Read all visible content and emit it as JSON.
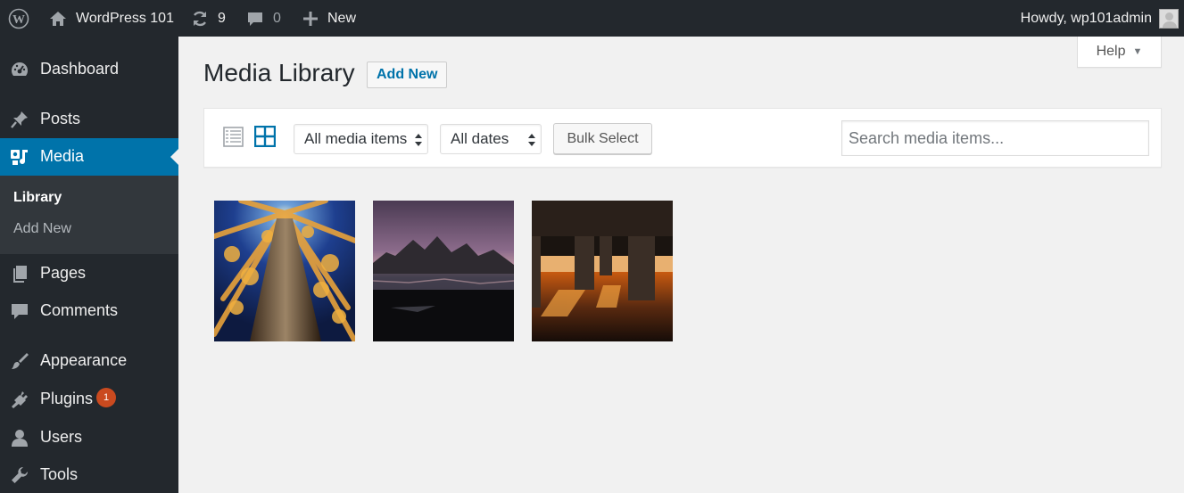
{
  "admin_bar": {
    "site_name": "WordPress 101",
    "updates_count": "9",
    "comments_count": "0",
    "new_label": "New",
    "howdy": "Howdy, wp101admin"
  },
  "sidebar": {
    "items": [
      {
        "label": "Dashboard",
        "icon": "dashboard-icon"
      },
      {
        "label": "Posts",
        "icon": "pin-icon"
      },
      {
        "label": "Media",
        "icon": "media-icon",
        "active": true
      },
      {
        "label": "Pages",
        "icon": "pages-icon"
      },
      {
        "label": "Comments",
        "icon": "comment-icon"
      },
      {
        "label": "Appearance",
        "icon": "brush-icon"
      },
      {
        "label": "Plugins",
        "icon": "plugin-icon",
        "badge": "1"
      },
      {
        "label": "Users",
        "icon": "users-icon"
      },
      {
        "label": "Tools",
        "icon": "wrench-icon"
      }
    ],
    "submenu": [
      {
        "label": "Library",
        "current": true
      },
      {
        "label": "Add New"
      }
    ]
  },
  "help": {
    "label": "Help"
  },
  "page": {
    "title": "Media Library",
    "add_new": "Add New"
  },
  "toolbar": {
    "type_filter": "All media items",
    "date_filter": "All dates",
    "bulk_select": "Bulk Select",
    "search_placeholder": "Search media items..."
  },
  "media_items": [
    {
      "subject": "autumn aspen trees looking up"
    },
    {
      "subject": "mountain lake at dusk"
    },
    {
      "subject": "parking garage at sunset"
    }
  ],
  "colors": {
    "admin_bar": "#23282d",
    "active_menu": "#0073aa",
    "badge": "#ca4a1f",
    "background": "#f1f1f1"
  }
}
